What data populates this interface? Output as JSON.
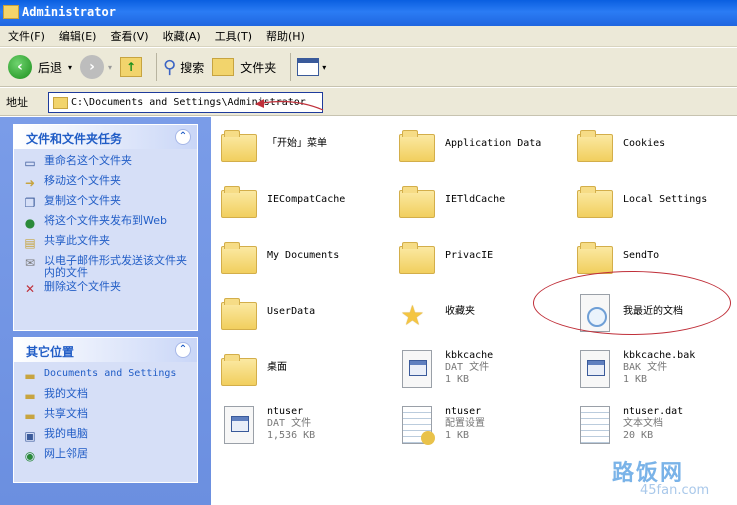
{
  "window": {
    "title": "Administrator"
  },
  "menu": [
    "文件(F)",
    "编辑(E)",
    "查看(V)",
    "收藏(A)",
    "工具(T)",
    "帮助(H)"
  ],
  "toolbar": {
    "back": "后退",
    "search": "搜索",
    "folders": "文件夹"
  },
  "address": {
    "label": "地址",
    "path": "C:\\Documents and Settings\\Administrator"
  },
  "tasks": {
    "title": "文件和文件夹任务",
    "items": [
      "重命名这个文件夹",
      "移动这个文件夹",
      "复制这个文件夹",
      "将这个文件夹发布到Web",
      "共享此文件夹",
      "以电子邮件形式发送该文件夹内的文件",
      "删除这个文件夹"
    ]
  },
  "other": {
    "title": "其它位置",
    "items": [
      "Documents and Settings",
      "我的文档",
      "共享文档",
      "我的电脑",
      "网上邻居"
    ]
  },
  "files": [
    {
      "name": "「开始」菜单",
      "type": "",
      "size": "",
      "icon": "folder"
    },
    {
      "name": "Application Data",
      "type": "",
      "size": "",
      "icon": "folder"
    },
    {
      "name": "Cookies",
      "type": "",
      "size": "",
      "icon": "folder"
    },
    {
      "name": "IECompatCache",
      "type": "",
      "size": "",
      "icon": "folder"
    },
    {
      "name": "IETldCache",
      "type": "",
      "size": "",
      "icon": "folder"
    },
    {
      "name": "Local Settings",
      "type": "",
      "size": "",
      "icon": "folder"
    },
    {
      "name": "My Documents",
      "type": "",
      "size": "",
      "icon": "folder"
    },
    {
      "name": "PrivacIE",
      "type": "",
      "size": "",
      "icon": "folder"
    },
    {
      "name": "SendTo",
      "type": "",
      "size": "",
      "icon": "folder"
    },
    {
      "name": "UserData",
      "type": "",
      "size": "",
      "icon": "folder"
    },
    {
      "name": "收藏夹",
      "type": "",
      "size": "",
      "icon": "star"
    },
    {
      "name": "我最近的文档",
      "type": "",
      "size": "",
      "icon": "recent"
    },
    {
      "name": "桌面",
      "type": "",
      "size": "",
      "icon": "folder"
    },
    {
      "name": "kbkcache",
      "type": "DAT 文件",
      "size": "1 KB",
      "icon": "doc"
    },
    {
      "name": "kbkcache.bak",
      "type": "BAK 文件",
      "size": "1 KB",
      "icon": "doc"
    },
    {
      "name": "ntuser",
      "type": "DAT 文件",
      "size": "1,536 KB",
      "icon": "doc"
    },
    {
      "name": "ntuser",
      "type": "配置设置",
      "size": "1 KB",
      "icon": "ini"
    },
    {
      "name": "ntuser.dat",
      "type": "文本文档",
      "size": "20 KB",
      "icon": "notepad"
    }
  ],
  "watermark": {
    "brand": "路饭网",
    "url": "45fan.com"
  }
}
